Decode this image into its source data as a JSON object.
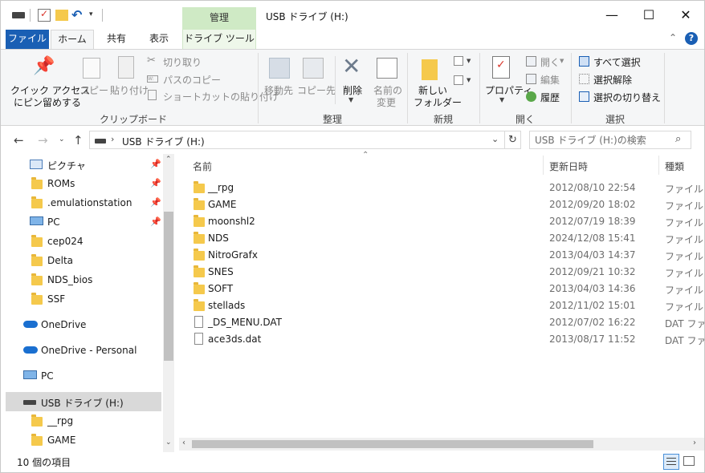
{
  "titlebar": {
    "context_tab": "管理",
    "title": "USB ドライブ (H:)",
    "minimize": "—",
    "maximize": "☐",
    "close": "✕"
  },
  "tabs": {
    "file": "ファイル",
    "home": "ホーム",
    "share": "共有",
    "view": "表示",
    "drive_tools": "ドライブ ツール"
  },
  "ribbon": {
    "pin_line1": "クイック アクセス",
    "pin_line2": "にピン留めする",
    "copy": "コピー",
    "paste": "貼り付け",
    "cut": "切り取り",
    "copy_path": "パスのコピー",
    "paste_shortcut": "ショートカットの貼り付け",
    "move_to": "移動先",
    "copy_to": "コピー先",
    "delete": "削除",
    "rename_line1": "名前の",
    "rename_line2": "変更",
    "new_folder_line1": "新しい",
    "new_folder_line2": "フォルダー",
    "properties": "プロパティ",
    "open": "開く",
    "edit": "編集",
    "history": "履歴",
    "select_all": "すべて選択",
    "select_none": "選択解除",
    "invert_selection": "選択の切り替え",
    "group_clipboard": "クリップボード",
    "group_organize": "整理",
    "group_new": "新規",
    "group_open": "開く",
    "group_select": "選択"
  },
  "address": {
    "path": "USB ドライブ (H:)",
    "search_placeholder": "USB ドライブ (H:)の検索"
  },
  "navpane": {
    "items": [
      {
        "label": "ピクチャ",
        "icon": "pictures-icon",
        "pinned": true
      },
      {
        "label": "ROMs",
        "icon": "folder-icon",
        "pinned": true
      },
      {
        "label": ".emulationstation",
        "icon": "folder-icon",
        "pinned": true
      },
      {
        "label": "PC",
        "icon": "pc-icon",
        "pinned": true
      },
      {
        "label": "cep024",
        "icon": "folder-icon",
        "pinned": false
      },
      {
        "label": "Delta",
        "icon": "folder-icon",
        "pinned": false
      },
      {
        "label": "NDS_bios",
        "icon": "folder-icon",
        "pinned": false
      },
      {
        "label": "SSF",
        "icon": "folder-icon",
        "pinned": false
      },
      {
        "label": "OneDrive",
        "icon": "onedrive-icon",
        "pinned": false
      },
      {
        "label": "OneDrive - Personal",
        "icon": "onedrive-icon",
        "pinned": false
      },
      {
        "label": "PC",
        "icon": "pc-icon",
        "pinned": false
      },
      {
        "label": "USB ドライブ (H:)",
        "icon": "usb-drive-icon",
        "pinned": false
      },
      {
        "label": "__rpg",
        "icon": "folder-icon",
        "pinned": false
      },
      {
        "label": "GAME",
        "icon": "folder-icon",
        "pinned": false
      }
    ]
  },
  "filelist": {
    "columns": {
      "name": "名前",
      "date": "更新日時",
      "type": "種類"
    },
    "rows": [
      {
        "name": "__rpg",
        "date": "2012/08/10 22:54",
        "type": "ファイル フォルダー",
        "kind": "folder"
      },
      {
        "name": "GAME",
        "date": "2012/09/20 18:02",
        "type": "ファイル フォルダー",
        "kind": "folder"
      },
      {
        "name": "moonshl2",
        "date": "2012/07/19 18:39",
        "type": "ファイル フォルダー",
        "kind": "folder"
      },
      {
        "name": "NDS",
        "date": "2024/12/08 15:41",
        "type": "ファイル フォルダー",
        "kind": "folder"
      },
      {
        "name": "NitroGrafx",
        "date": "2013/04/03 14:37",
        "type": "ファイル フォルダー",
        "kind": "folder"
      },
      {
        "name": "SNES",
        "date": "2012/09/21 10:32",
        "type": "ファイル フォルダー",
        "kind": "folder"
      },
      {
        "name": "SOFT",
        "date": "2013/04/03 14:36",
        "type": "ファイル フォルダー",
        "kind": "folder"
      },
      {
        "name": "stellads",
        "date": "2012/11/02 15:01",
        "type": "ファイル フォルダー",
        "kind": "folder"
      },
      {
        "name": "_DS_MENU.DAT",
        "date": "2012/07/02 16:22",
        "type": "DAT ファイル",
        "kind": "file"
      },
      {
        "name": "ace3ds.dat",
        "date": "2013/08/17 11:52",
        "type": "DAT ファイル",
        "kind": "file"
      }
    ]
  },
  "status": {
    "item_count": "10 個の項目"
  }
}
